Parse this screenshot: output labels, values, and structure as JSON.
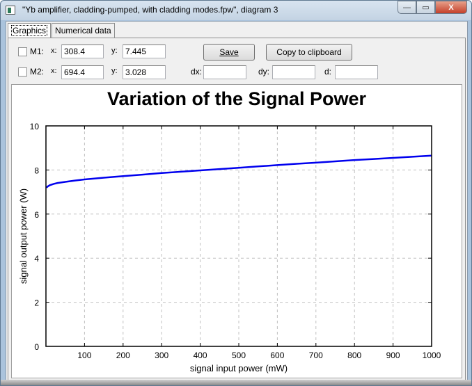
{
  "window": {
    "title": "\"Yb amplifier, cladding-pumped, with cladding modes.fpw\", diagram 3",
    "buttons": {
      "minimize": "—",
      "maximize": "▭",
      "close": "X"
    }
  },
  "tabs": [
    {
      "label": "Graphics",
      "active": true
    },
    {
      "label": "Numerical data",
      "active": false
    }
  ],
  "markers": {
    "m1": {
      "label": "M1:",
      "checked": false,
      "x_label": "x:",
      "x_value": "308.4",
      "y_label": "y:",
      "y_value": "7.445"
    },
    "m2": {
      "label": "M2:",
      "checked": false,
      "x_label": "x:",
      "x_value": "694.4",
      "y_label": "y:",
      "y_value": "3.028"
    },
    "dx_label": "dx:",
    "dx_value": "",
    "dy_label": "dy:",
    "dy_value": "",
    "d_label": "d:",
    "d_value": ""
  },
  "toolbar": {
    "save_label": "Save",
    "copy_label": "Copy to clipboard"
  },
  "chart_data": {
    "type": "line",
    "title": "Variation of the Signal Power",
    "xlabel": "signal input power (mW)",
    "ylabel": "signal output power (W)",
    "xlim": [
      0,
      1000
    ],
    "ylim": [
      0,
      10
    ],
    "xticks": [
      100,
      200,
      300,
      400,
      500,
      600,
      700,
      800,
      900,
      1000
    ],
    "yticks": [
      0,
      2,
      4,
      6,
      8,
      10
    ],
    "grid": true,
    "line_color": "#0000ee",
    "series": [
      {
        "name": "signal output power",
        "x": [
          1,
          5,
          10,
          20,
          30,
          50,
          75,
          100,
          150,
          200,
          250,
          300,
          350,
          400,
          450,
          500,
          550,
          600,
          650,
          700,
          750,
          800,
          850,
          900,
          950,
          1000
        ],
        "y": [
          7.2,
          7.26,
          7.31,
          7.37,
          7.41,
          7.46,
          7.52,
          7.57,
          7.65,
          7.72,
          7.79,
          7.86,
          7.92,
          7.98,
          8.04,
          8.1,
          8.16,
          8.22,
          8.28,
          8.33,
          8.39,
          8.45,
          8.5,
          8.55,
          8.6,
          8.65
        ]
      }
    ]
  }
}
